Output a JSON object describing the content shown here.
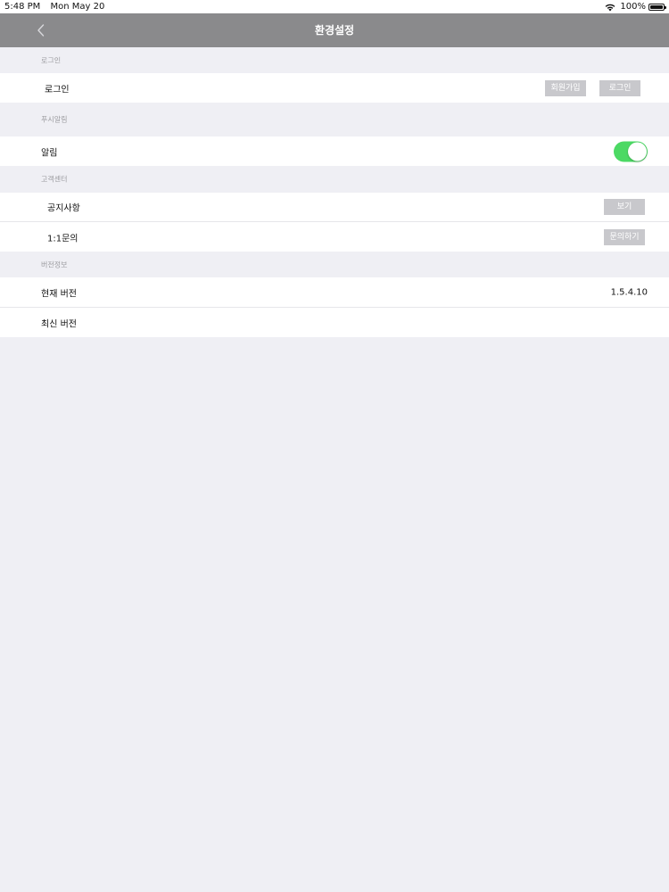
{
  "status_bar": {
    "time": "5:48 PM",
    "date": "Mon May 20",
    "battery_text": "100%",
    "battery_level": 1.0
  },
  "nav": {
    "title": "환경설정",
    "back_icon": "chevron-left-icon"
  },
  "sections": {
    "login": {
      "header": "로그인",
      "row_label": "로그인",
      "signup_button": "회원가입",
      "login_button": "로그인"
    },
    "push": {
      "header": "푸시알림",
      "row_label": "알림",
      "toggle_on": true,
      "toggle_color": "#4cd964"
    },
    "support": {
      "header": "고객센터",
      "notice_label": "공지사항",
      "notice_button": "보기",
      "inquiry_label": "1:1문의",
      "inquiry_button": "문의하기"
    },
    "version": {
      "header": "버전정보",
      "current_label": "현재 버전",
      "current_value": "1.5.4.10",
      "latest_label": "최신 버전"
    }
  },
  "colors": {
    "nav_background": "#8a8a8c",
    "page_background": "#efeff4",
    "button_gray": "#c8c8cc"
  }
}
